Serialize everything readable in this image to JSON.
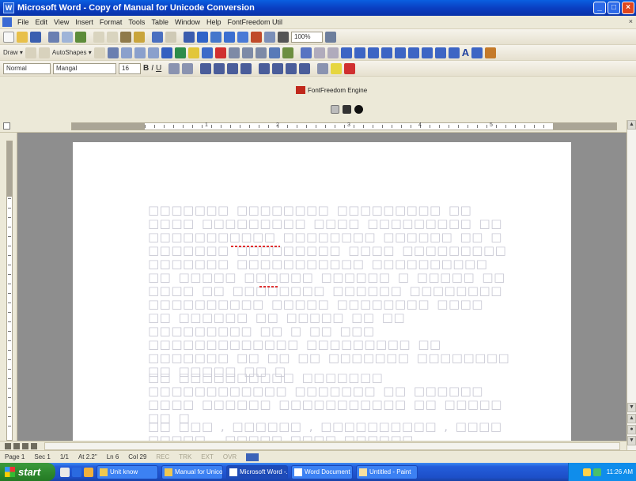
{
  "window": {
    "app_icon": "W",
    "title": "Microsoft Word - Copy of Manual for Unicode Conversion",
    "buttons": {
      "minimize": "_",
      "maximize": "□",
      "close": "×"
    }
  },
  "menu": {
    "items": [
      "File",
      "Edit",
      "View",
      "Insert",
      "Format",
      "Tools",
      "Table",
      "Window",
      "Help",
      "FontFreedom Util"
    ],
    "close_doc": "×"
  },
  "toolbars": {
    "zoom": "100%",
    "draw_label": "Draw ▾",
    "autoshapes_label": "AutoShapes ▾",
    "style": "Normal",
    "font": "Mangal",
    "size": "16",
    "bold": "B",
    "italic": "I",
    "underline": "U",
    "big_a": "A"
  },
  "fontfreedom": {
    "engine_label": "FontFreedom Engine"
  },
  "ruler": {
    "numbers": [
      "1",
      "2",
      "3",
      "4",
      "5"
    ]
  },
  "document": {
    "paragraphs": [
      "□□□□□□□ □□□□□□□□ □□□□□□□□□ □□ □□□□ □□□□□□□□□ □□□□ □□□□□□□□□ □□ □□□□□□□□□□□ □□□□□□□□ □□□□□□ □□ □ □□□□□□□ □□□□□□□□□ □□□□ □□□□□□□□□ □□□□□□□ □□□□□□□□□□□ □□□□□□□□□□ □□ □□□□□ □□□□□□ □□□□□□ □ □□□□□ □□ □□□□ □□ □□□□□□□□ □□□□□□ □□□□□□□□ □□□□□□□□□□ □□□□□ □□□□□□□□ □□□□ □□ □□□□□□ □□ □□□□□ □□ □□ □□□□□□□□□ □□ □ □□ □□□ □□□□□□□□□□□□□ □□□□□□□□□ □□ □□□□□□□ □□ □□ □□ □□□□□□□ □□□□□□□□ □□ □□□□□ □□ □",
      "□□ □□□□□□□□□□ □□□□□□□ □□□□□□□□□□□□ □□□□□□□ □□ □□□□□□ □□□□ □□□□□□ □□□□□□□□□□□ □□ □□□□□ □□ □",
      "□□ □□□ , □□□□□□ , □□□□□□□□□□ , □□□□ □□□□□ , □□□□□ □□□□ □□□□□□ □□□□□□□□ □□□□□□□□□□□□□□□"
    ]
  },
  "status": {
    "page": "Page 1",
    "section": "Sec 1",
    "pages": "1/1",
    "at": "At 2.2\"",
    "ln": "Ln 6",
    "col": "Col 29",
    "rec": "REC",
    "trk": "TRK",
    "ext": "EXT",
    "ovr": "OVR"
  },
  "taskbar": {
    "start": "start",
    "tasks": [
      "Unit know",
      "Manual for Unico...",
      "Microsoft Word -...",
      "Word Document",
      "Untitled - Paint"
    ],
    "clock": "11:26 AM"
  }
}
